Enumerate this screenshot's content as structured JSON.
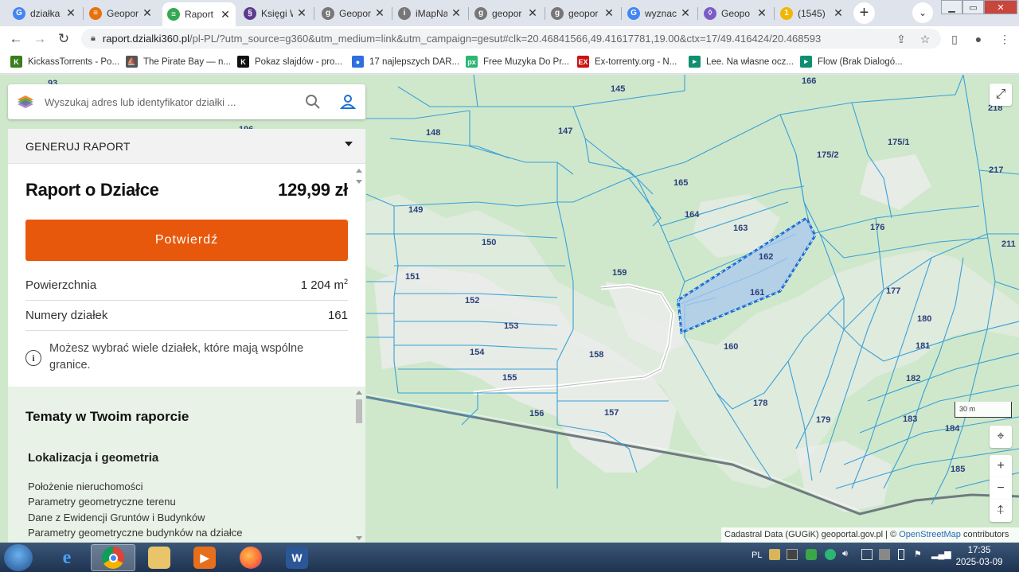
{
  "browser": {
    "tabs": [
      {
        "title": "działka",
        "fav": "G",
        "favColor": "#4285f4",
        "active": false
      },
      {
        "title": "Geopor",
        "fav": "≡",
        "favColor": "#e8710a",
        "active": false
      },
      {
        "title": "Raport",
        "fav": "≡",
        "favColor": "#34a853",
        "active": true
      },
      {
        "title": "Księgi W",
        "fav": "§",
        "favColor": "#5c3b8c",
        "active": false
      },
      {
        "title": "Geopor",
        "fav": "g",
        "favColor": "#777777",
        "active": false
      },
      {
        "title": "iMapNa",
        "fav": "i",
        "favColor": "#777777",
        "active": false
      },
      {
        "title": "geopor",
        "fav": "g",
        "favColor": "#777777",
        "active": false
      },
      {
        "title": "geopor",
        "fav": "g",
        "favColor": "#777777",
        "active": false
      },
      {
        "title": "wyznac",
        "fav": "G",
        "favColor": "#4285f4",
        "active": false
      },
      {
        "title": "Geopo",
        "fav": "◊",
        "favColor": "#7a5cc8",
        "active": false
      },
      {
        "title": "(1545)",
        "fav": "1",
        "favColor": "#f2b600",
        "active": false
      }
    ],
    "close_glyph": "✕",
    "newtab_glyph": "+",
    "tabmenu_glyph": "⌄",
    "url_host": "raport.dzialki360.pl",
    "url_path": "/pl-PL/?utm_source=g360&utm_medium=link&utm_campaign=gesut#clk=20.46841566,49.41617781,19.00&ctx=17/49.416424/20.468593",
    "bookmarks": [
      {
        "label": "KickassTorrents - Po...",
        "icon": "K",
        "color": "#3a7d1e"
      },
      {
        "label": "The Pirate Bay — n...",
        "icon": "⛵",
        "color": "#555555"
      },
      {
        "label": "Pokaz slajdów - pro...",
        "icon": "K",
        "color": "#111111"
      },
      {
        "label": "17 najlepszych DAR...",
        "icon": "●",
        "color": "#2f6fde"
      },
      {
        "label": "Free Muzyka Do Pr...",
        "icon": "px",
        "color": "#2bb673"
      },
      {
        "label": "Ex-torrenty.org - N...",
        "icon": "EX",
        "color": "#cc1111"
      },
      {
        "label": "Lee. Na własne ocz...",
        "icon": "▸",
        "color": "#0f8f6f"
      },
      {
        "label": "Flow (Brak Dialogó...",
        "icon": "▸",
        "color": "#0f8f6f"
      }
    ]
  },
  "search": {
    "placeholder": "Wyszukaj adres lub identyfikator działki ..."
  },
  "panel": {
    "generate_header": "GENERUJ RAPORT",
    "report_title": "Raport o Działce",
    "price": "129,99 zł",
    "confirm_label": "Potwierdź",
    "area_label": "Powierzchnia",
    "area_value": "1 204 m",
    "area_unit_sup": "2",
    "parcel_numbers_label": "Numery działek",
    "parcel_numbers_value": "161",
    "info_text": "Możesz wybrać wiele działek, które mają wspólne granice.",
    "topics_title": "Tematy w Twoim raporcie",
    "section_title": "Lokalizacja i geometria",
    "topic_items": [
      "Położenie nieruchomości",
      "Parametry geometryczne terenu",
      "Dane z Ewidencji Gruntów i Budynków",
      "Parametry geometryczne budynków na działce"
    ]
  },
  "map": {
    "parcels": [
      "145",
      "166",
      "218",
      "148",
      "147",
      "175/2",
      "175/1",
      "217",
      "165",
      "164",
      "163",
      "176",
      "149",
      "211",
      "150",
      "162",
      "159",
      "161",
      "151",
      "177",
      "152",
      "180",
      "153",
      "160",
      "181",
      "154",
      "158",
      "182",
      "155",
      "178",
      "156",
      "157",
      "179",
      "183",
      "184",
      "185",
      "93",
      "196"
    ],
    "selected_parcel": "161",
    "scale_label": "30 m",
    "attribution_prefix": "Cadastral Data (GUGiK) geoportal.gov.pl | © ",
    "attribution_link": "OpenStreetMap",
    "attribution_suffix": " contributors",
    "zoom_in": "+",
    "zoom_out": "−",
    "reset_north": "⍏",
    "locate": "⌖",
    "fullscreen": "⤢"
  },
  "taskbar": {
    "lang": "PL",
    "time": "17:35",
    "date": "2025-03-09",
    "apps": [
      "ie",
      "chrome",
      "explorer",
      "media",
      "firefox",
      "word"
    ]
  },
  "colors": {
    "accent": "#e8580c",
    "parcel_line": "#3aa0d8",
    "selection_fill": "#a9c8f0",
    "selection_stroke": "#1e6ed6",
    "map_green": "#cfe8cb",
    "topics_bg": "#e8f2e6"
  }
}
